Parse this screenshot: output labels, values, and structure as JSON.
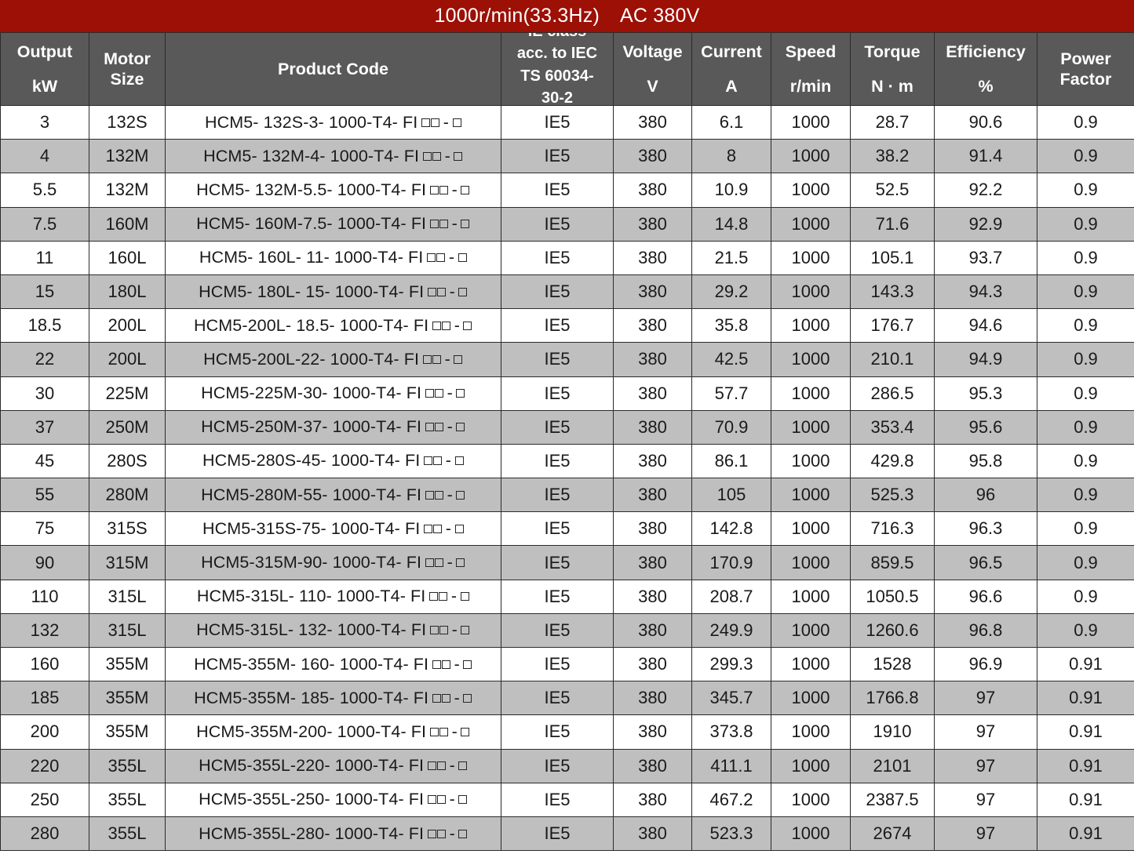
{
  "title": {
    "speed": "1000r/min(33.3Hz)",
    "voltage": "AC 380V",
    "background_color": "#9c1006"
  },
  "header": {
    "background_color": "#595959",
    "text_color": "#ffffff",
    "columns": [
      {
        "name": "output",
        "line1": "Output",
        "line2": "kW"
      },
      {
        "name": "motor-size",
        "line1": "Motor",
        "line2": "Size"
      },
      {
        "name": "product-code",
        "line1": "Product Code",
        "line2": ""
      },
      {
        "name": "ie-class",
        "line1": "IE class",
        "line2": "acc. to IEC",
        "line3": "TS 60034-",
        "line4": "30-2"
      },
      {
        "name": "voltage",
        "line1": "Voltage",
        "line2": "V"
      },
      {
        "name": "current",
        "line1": "Current",
        "line2": "A"
      },
      {
        "name": "speed",
        "line1": "Speed",
        "line2": "r/min"
      },
      {
        "name": "torque",
        "line1": "Torque",
        "line2": "N · m"
      },
      {
        "name": "efficiency",
        "line1": "Efficiency",
        "line2": "%"
      },
      {
        "name": "power-factor",
        "line1": "Power",
        "line2": "Factor"
      }
    ]
  },
  "code_format": {
    "placeholder_glyph": "□",
    "suffix_note": "FI □□ - □"
  },
  "rows": [
    {
      "output": "3",
      "size": "132S",
      "code_prefix": "HCM5- 132S-3- 1000-T4- FI",
      "ie": "IE5",
      "voltage": "380",
      "current": "6.1",
      "speed": "1000",
      "torque": "28.7",
      "efficiency": "90.6",
      "power_factor": "0.9"
    },
    {
      "output": "4",
      "size": "132M",
      "code_prefix": "HCM5- 132M-4- 1000-T4- FI",
      "ie": "IE5",
      "voltage": "380",
      "current": "8",
      "speed": "1000",
      "torque": "38.2",
      "efficiency": "91.4",
      "power_factor": "0.9"
    },
    {
      "output": "5.5",
      "size": "132M",
      "code_prefix": "HCM5- 132M-5.5- 1000-T4- FI",
      "ie": "IE5",
      "voltage": "380",
      "current": "10.9",
      "speed": "1000",
      "torque": "52.5",
      "efficiency": "92.2",
      "power_factor": "0.9"
    },
    {
      "output": "7.5",
      "size": "160M",
      "code_prefix": "HCM5- 160M-7.5- 1000-T4- FI",
      "ie": "IE5",
      "voltage": "380",
      "current": "14.8",
      "speed": "1000",
      "torque": "71.6",
      "efficiency": "92.9",
      "power_factor": "0.9"
    },
    {
      "output": "11",
      "size": "160L",
      "code_prefix": "HCM5- 160L- 11- 1000-T4- FI",
      "ie": "IE5",
      "voltage": "380",
      "current": "21.5",
      "speed": "1000",
      "torque": "105.1",
      "efficiency": "93.7",
      "power_factor": "0.9"
    },
    {
      "output": "15",
      "size": "180L",
      "code_prefix": "HCM5- 180L- 15- 1000-T4- FI",
      "ie": "IE5",
      "voltage": "380",
      "current": "29.2",
      "speed": "1000",
      "torque": "143.3",
      "efficiency": "94.3",
      "power_factor": "0.9"
    },
    {
      "output": "18.5",
      "size": "200L",
      "code_prefix": "HCM5-200L- 18.5- 1000-T4- FI",
      "ie": "IE5",
      "voltage": "380",
      "current": "35.8",
      "speed": "1000",
      "torque": "176.7",
      "efficiency": "94.6",
      "power_factor": "0.9"
    },
    {
      "output": "22",
      "size": "200L",
      "code_prefix": "HCM5-200L-22- 1000-T4- FI",
      "ie": "IE5",
      "voltage": "380",
      "current": "42.5",
      "speed": "1000",
      "torque": "210.1",
      "efficiency": "94.9",
      "power_factor": "0.9"
    },
    {
      "output": "30",
      "size": "225M",
      "code_prefix": "HCM5-225M-30- 1000-T4- FI",
      "ie": "IE5",
      "voltage": "380",
      "current": "57.7",
      "speed": "1000",
      "torque": "286.5",
      "efficiency": "95.3",
      "power_factor": "0.9"
    },
    {
      "output": "37",
      "size": "250M",
      "code_prefix": "HCM5-250M-37- 1000-T4- FI",
      "ie": "IE5",
      "voltage": "380",
      "current": "70.9",
      "speed": "1000",
      "torque": "353.4",
      "efficiency": "95.6",
      "power_factor": "0.9"
    },
    {
      "output": "45",
      "size": "280S",
      "code_prefix": "HCM5-280S-45- 1000-T4- FI",
      "ie": "IE5",
      "voltage": "380",
      "current": "86.1",
      "speed": "1000",
      "torque": "429.8",
      "efficiency": "95.8",
      "power_factor": "0.9"
    },
    {
      "output": "55",
      "size": "280M",
      "code_prefix": "HCM5-280M-55- 1000-T4- FI",
      "ie": "IE5",
      "voltage": "380",
      "current": "105",
      "speed": "1000",
      "torque": "525.3",
      "efficiency": "96",
      "power_factor": "0.9"
    },
    {
      "output": "75",
      "size": "315S",
      "code_prefix": "HCM5-315S-75- 1000-T4- FI",
      "ie": "IE5",
      "voltage": "380",
      "current": "142.8",
      "speed": "1000",
      "torque": "716.3",
      "efficiency": "96.3",
      "power_factor": "0.9"
    },
    {
      "output": "90",
      "size": "315M",
      "code_prefix": "HCM5-315M-90- 1000-T4- FI",
      "ie": "IE5",
      "voltage": "380",
      "current": "170.9",
      "speed": "1000",
      "torque": "859.5",
      "efficiency": "96.5",
      "power_factor": "0.9"
    },
    {
      "output": "110",
      "size": "315L",
      "code_prefix": "HCM5-315L- 110- 1000-T4- FI",
      "ie": "IE5",
      "voltage": "380",
      "current": "208.7",
      "speed": "1000",
      "torque": "1050.5",
      "efficiency": "96.6",
      "power_factor": "0.9"
    },
    {
      "output": "132",
      "size": "315L",
      "code_prefix": "HCM5-315L- 132- 1000-T4- FI",
      "ie": "IE5",
      "voltage": "380",
      "current": "249.9",
      "speed": "1000",
      "torque": "1260.6",
      "efficiency": "96.8",
      "power_factor": "0.9"
    },
    {
      "output": "160",
      "size": "355M",
      "code_prefix": "HCM5-355M- 160- 1000-T4- FI",
      "ie": "IE5",
      "voltage": "380",
      "current": "299.3",
      "speed": "1000",
      "torque": "1528",
      "efficiency": "96.9",
      "power_factor": "0.91"
    },
    {
      "output": "185",
      "size": "355M",
      "code_prefix": "HCM5-355M- 185- 1000-T4- FI",
      "ie": "IE5",
      "voltage": "380",
      "current": "345.7",
      "speed": "1000",
      "torque": "1766.8",
      "efficiency": "97",
      "power_factor": "0.91"
    },
    {
      "output": "200",
      "size": "355M",
      "code_prefix": "HCM5-355M-200- 1000-T4- FI",
      "ie": "IE5",
      "voltage": "380",
      "current": "373.8",
      "speed": "1000",
      "torque": "1910",
      "efficiency": "97",
      "power_factor": "0.91"
    },
    {
      "output": "220",
      "size": "355L",
      "code_prefix": "HCM5-355L-220- 1000-T4- FI",
      "ie": "IE5",
      "voltage": "380",
      "current": "411.1",
      "speed": "1000",
      "torque": "2101",
      "efficiency": "97",
      "power_factor": "0.91"
    },
    {
      "output": "250",
      "size": "355L",
      "code_prefix": "HCM5-355L-250- 1000-T4- FI",
      "ie": "IE5",
      "voltage": "380",
      "current": "467.2",
      "speed": "1000",
      "torque": "2387.5",
      "efficiency": "97",
      "power_factor": "0.91"
    },
    {
      "output": "280",
      "size": "355L",
      "code_prefix": "HCM5-355L-280- 1000-T4- FI",
      "ie": "IE5",
      "voltage": "380",
      "current": "523.3",
      "speed": "1000",
      "torque": "2674",
      "efficiency": "97",
      "power_factor": "0.91"
    }
  ]
}
